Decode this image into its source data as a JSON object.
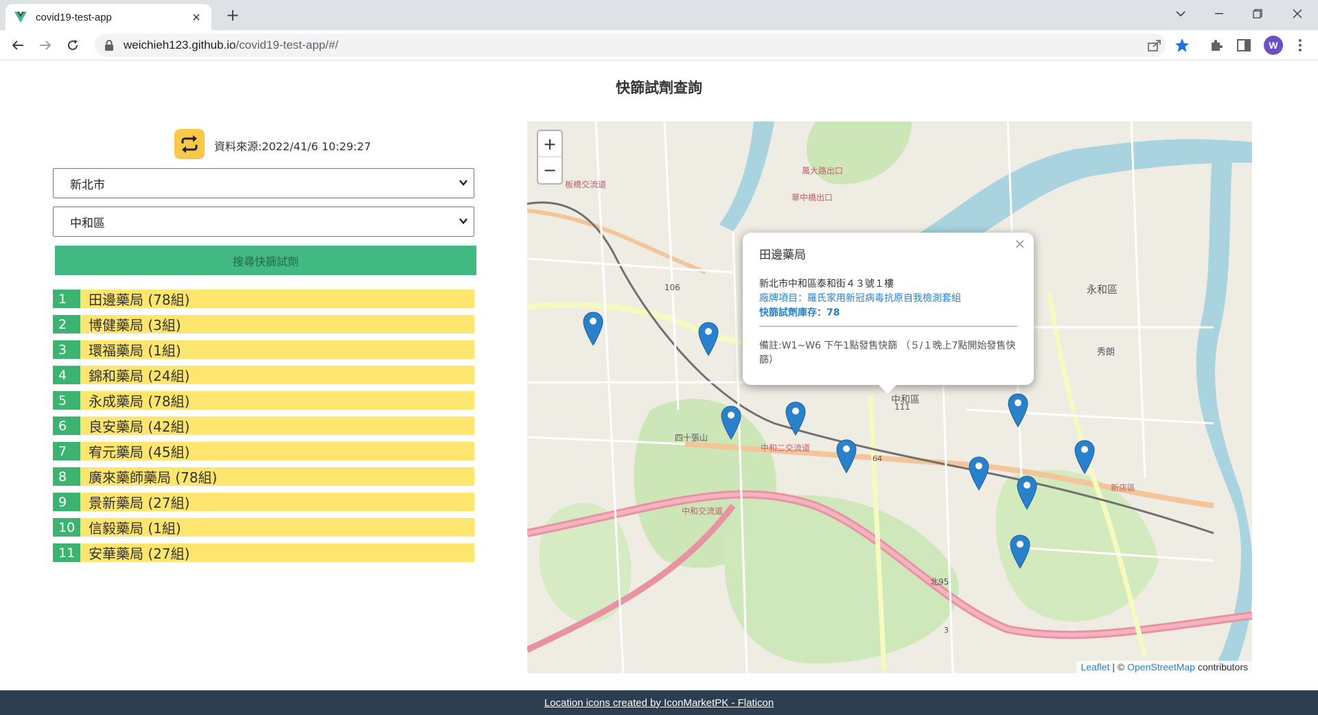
{
  "browser": {
    "tab_title": "covid19-test-app",
    "url_domain": "weichieh123.github.io",
    "url_path": "/covid19-test-app/#/",
    "profile_initial": "W"
  },
  "page": {
    "title": "快篩試劑查詢",
    "source_text": "資料來源:2022/41/6 10:29:27",
    "city_select": "新北市",
    "district_select": "中和區",
    "search_button": "搜尋快篩試劑"
  },
  "pharmacies": [
    {
      "num": "1",
      "name": "田邊藥局 (78組)"
    },
    {
      "num": "2",
      "name": "博健藥局 (3組)"
    },
    {
      "num": "3",
      "name": "環福藥局 (1組)"
    },
    {
      "num": "4",
      "name": "錦和藥局 (24組)"
    },
    {
      "num": "5",
      "name": "永成藥局 (78組)"
    },
    {
      "num": "6",
      "name": "良安藥局 (42組)"
    },
    {
      "num": "7",
      "name": "宥元藥局 (45組)"
    },
    {
      "num": "8",
      "name": "廣來藥師藥局 (78組)"
    },
    {
      "num": "9",
      "name": "景新藥局 (27組)"
    },
    {
      "num": "10",
      "name": "信毅藥局 (1組)"
    },
    {
      "num": "11",
      "name": "安華藥局 (27組)"
    }
  ],
  "map": {
    "zoom_in": "+",
    "zoom_out": "−",
    "popup": {
      "title": "田邊藥局",
      "address": "新北市中和區泰和街４３號１樓",
      "brand": "廠牌項目：羅氏家用新冠病毒抗原自我檢測套組",
      "stock": "快篩試劑庫存：78",
      "note": "備註:W1~W6 下午1點發售快篩 （５/１晚上7點開始發售快篩）",
      "close": "×"
    },
    "attribution": {
      "leaflet": "Leaflet",
      "sep": " | © ",
      "osm": "OpenStreetMap",
      "contributors": " contributors"
    },
    "road_labels": [
      "106",
      "64",
      "111",
      "3",
      "中和區",
      "永和區",
      "秀朗",
      "四十張山",
      "中和二交流道",
      "中和交流道",
      "板橋交流道",
      "萬大路出口",
      "華中橋出口",
      "北95",
      "新店區"
    ],
    "marker_color": "#2a81cb"
  },
  "footer": {
    "text": "Location icons created by IconMarketPK - Flaticon"
  }
}
